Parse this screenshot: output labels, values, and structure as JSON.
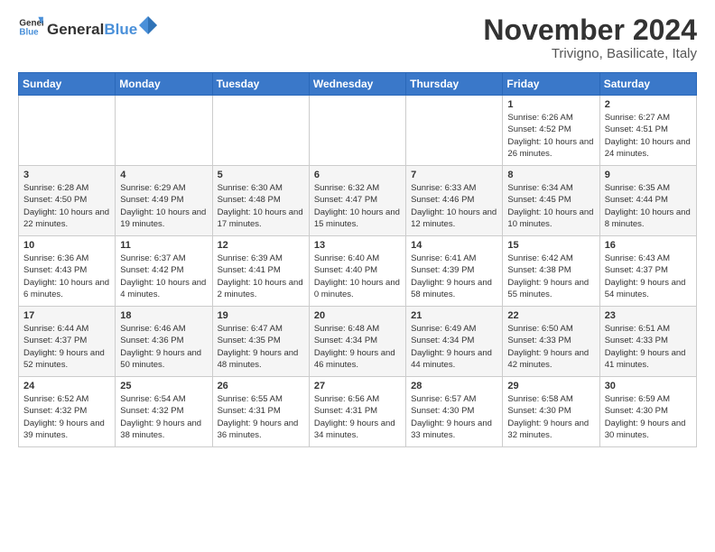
{
  "logo": {
    "general": "General",
    "blue": "Blue"
  },
  "title": "November 2024",
  "location": "Trivigno, Basilicate, Italy",
  "headers": [
    "Sunday",
    "Monday",
    "Tuesday",
    "Wednesday",
    "Thursday",
    "Friday",
    "Saturday"
  ],
  "weeks": [
    [
      {
        "day": "",
        "info": ""
      },
      {
        "day": "",
        "info": ""
      },
      {
        "day": "",
        "info": ""
      },
      {
        "day": "",
        "info": ""
      },
      {
        "day": "",
        "info": ""
      },
      {
        "day": "1",
        "info": "Sunrise: 6:26 AM\nSunset: 4:52 PM\nDaylight: 10 hours and 26 minutes."
      },
      {
        "day": "2",
        "info": "Sunrise: 6:27 AM\nSunset: 4:51 PM\nDaylight: 10 hours and 24 minutes."
      }
    ],
    [
      {
        "day": "3",
        "info": "Sunrise: 6:28 AM\nSunset: 4:50 PM\nDaylight: 10 hours and 22 minutes."
      },
      {
        "day": "4",
        "info": "Sunrise: 6:29 AM\nSunset: 4:49 PM\nDaylight: 10 hours and 19 minutes."
      },
      {
        "day": "5",
        "info": "Sunrise: 6:30 AM\nSunset: 4:48 PM\nDaylight: 10 hours and 17 minutes."
      },
      {
        "day": "6",
        "info": "Sunrise: 6:32 AM\nSunset: 4:47 PM\nDaylight: 10 hours and 15 minutes."
      },
      {
        "day": "7",
        "info": "Sunrise: 6:33 AM\nSunset: 4:46 PM\nDaylight: 10 hours and 12 minutes."
      },
      {
        "day": "8",
        "info": "Sunrise: 6:34 AM\nSunset: 4:45 PM\nDaylight: 10 hours and 10 minutes."
      },
      {
        "day": "9",
        "info": "Sunrise: 6:35 AM\nSunset: 4:44 PM\nDaylight: 10 hours and 8 minutes."
      }
    ],
    [
      {
        "day": "10",
        "info": "Sunrise: 6:36 AM\nSunset: 4:43 PM\nDaylight: 10 hours and 6 minutes."
      },
      {
        "day": "11",
        "info": "Sunrise: 6:37 AM\nSunset: 4:42 PM\nDaylight: 10 hours and 4 minutes."
      },
      {
        "day": "12",
        "info": "Sunrise: 6:39 AM\nSunset: 4:41 PM\nDaylight: 10 hours and 2 minutes."
      },
      {
        "day": "13",
        "info": "Sunrise: 6:40 AM\nSunset: 4:40 PM\nDaylight: 10 hours and 0 minutes."
      },
      {
        "day": "14",
        "info": "Sunrise: 6:41 AM\nSunset: 4:39 PM\nDaylight: 9 hours and 58 minutes."
      },
      {
        "day": "15",
        "info": "Sunrise: 6:42 AM\nSunset: 4:38 PM\nDaylight: 9 hours and 55 minutes."
      },
      {
        "day": "16",
        "info": "Sunrise: 6:43 AM\nSunset: 4:37 PM\nDaylight: 9 hours and 54 minutes."
      }
    ],
    [
      {
        "day": "17",
        "info": "Sunrise: 6:44 AM\nSunset: 4:37 PM\nDaylight: 9 hours and 52 minutes."
      },
      {
        "day": "18",
        "info": "Sunrise: 6:46 AM\nSunset: 4:36 PM\nDaylight: 9 hours and 50 minutes."
      },
      {
        "day": "19",
        "info": "Sunrise: 6:47 AM\nSunset: 4:35 PM\nDaylight: 9 hours and 48 minutes."
      },
      {
        "day": "20",
        "info": "Sunrise: 6:48 AM\nSunset: 4:34 PM\nDaylight: 9 hours and 46 minutes."
      },
      {
        "day": "21",
        "info": "Sunrise: 6:49 AM\nSunset: 4:34 PM\nDaylight: 9 hours and 44 minutes."
      },
      {
        "day": "22",
        "info": "Sunrise: 6:50 AM\nSunset: 4:33 PM\nDaylight: 9 hours and 42 minutes."
      },
      {
        "day": "23",
        "info": "Sunrise: 6:51 AM\nSunset: 4:33 PM\nDaylight: 9 hours and 41 minutes."
      }
    ],
    [
      {
        "day": "24",
        "info": "Sunrise: 6:52 AM\nSunset: 4:32 PM\nDaylight: 9 hours and 39 minutes."
      },
      {
        "day": "25",
        "info": "Sunrise: 6:54 AM\nSunset: 4:32 PM\nDaylight: 9 hours and 38 minutes."
      },
      {
        "day": "26",
        "info": "Sunrise: 6:55 AM\nSunset: 4:31 PM\nDaylight: 9 hours and 36 minutes."
      },
      {
        "day": "27",
        "info": "Sunrise: 6:56 AM\nSunset: 4:31 PM\nDaylight: 9 hours and 34 minutes."
      },
      {
        "day": "28",
        "info": "Sunrise: 6:57 AM\nSunset: 4:30 PM\nDaylight: 9 hours and 33 minutes."
      },
      {
        "day": "29",
        "info": "Sunrise: 6:58 AM\nSunset: 4:30 PM\nDaylight: 9 hours and 32 minutes."
      },
      {
        "day": "30",
        "info": "Sunrise: 6:59 AM\nSunset: 4:30 PM\nDaylight: 9 hours and 30 minutes."
      }
    ]
  ]
}
